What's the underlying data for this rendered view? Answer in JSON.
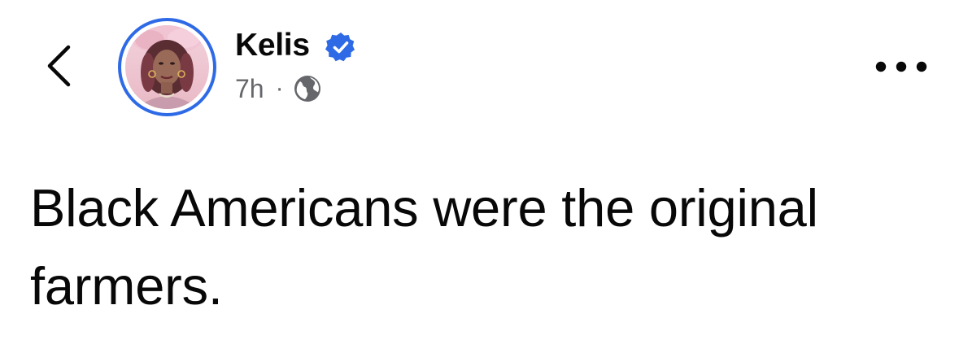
{
  "header": {
    "back_icon": "chevron-left-icon",
    "author": {
      "name": "Kelis",
      "verified_icon": "verified-badge-icon",
      "avatar_ring_color": "#2f6ae6"
    },
    "meta": {
      "time": "7h",
      "separator": "·",
      "audience_icon": "globe-icon"
    },
    "more_icon": "more-horizontal-icon"
  },
  "post": {
    "text": "Black Americans were the original farmers."
  },
  "colors": {
    "text_primary": "#080809",
    "text_secondary": "#65676b",
    "accent": "#2f6ae6",
    "background": "#ffffff"
  }
}
